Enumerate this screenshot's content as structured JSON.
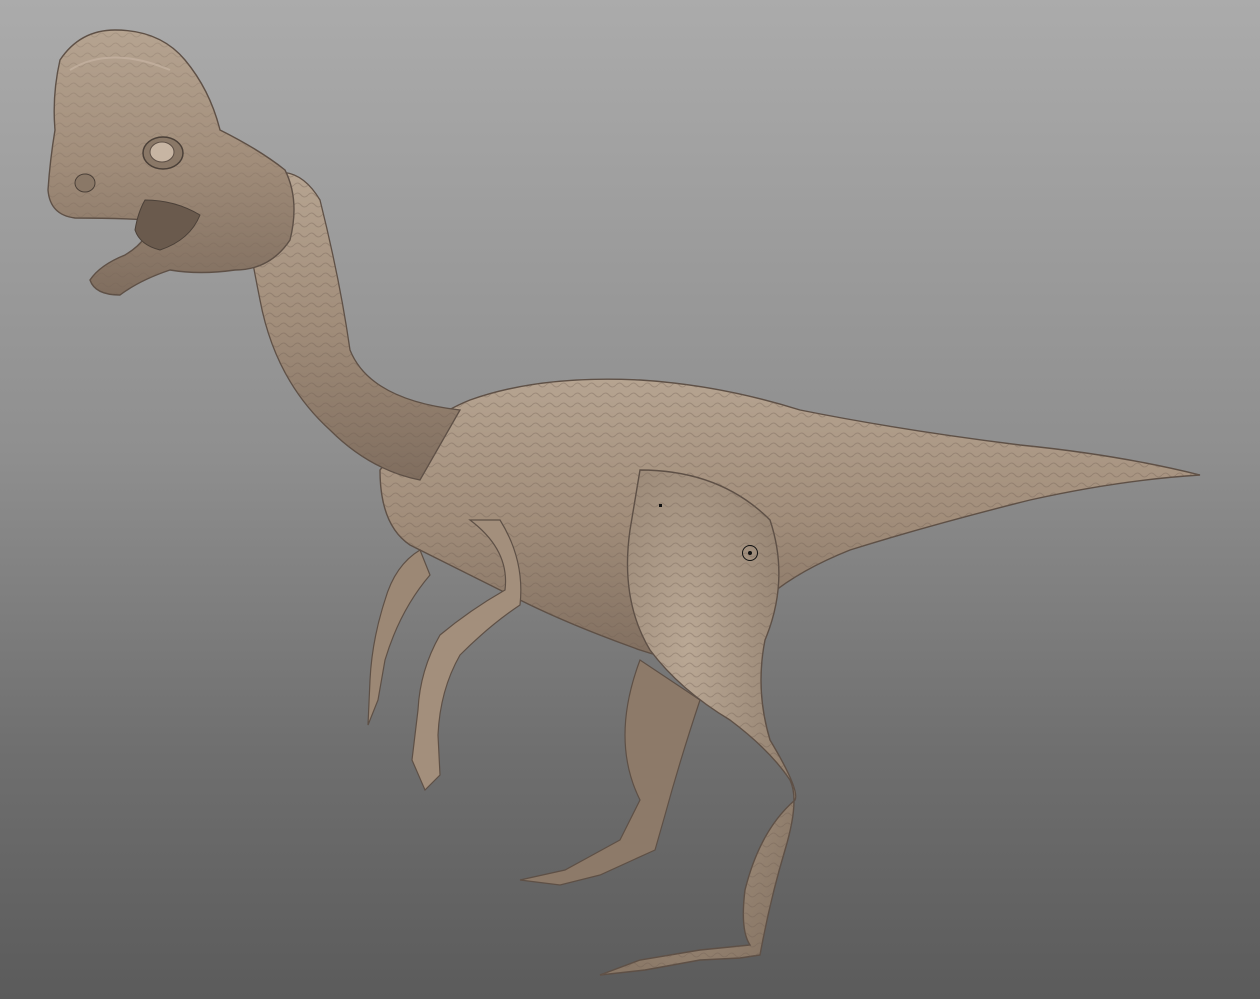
{
  "viewport": {
    "background_top": "#ababab",
    "background_bottom": "#5b5b5b"
  },
  "model": {
    "icon": "dinosaur-sculpt",
    "material_color": "#a69382",
    "material_shadow": "#6e5f53",
    "material_highlight": "#c9b8a7"
  },
  "gizmo": {
    "icon": "transform-pivot-icon"
  }
}
